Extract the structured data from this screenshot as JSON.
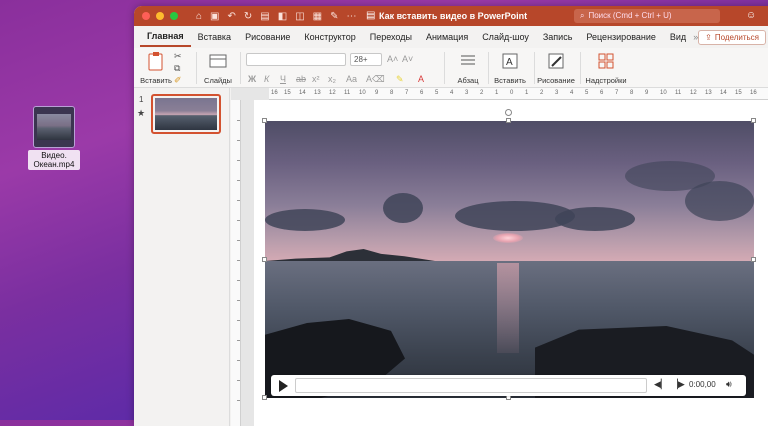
{
  "desktop": {
    "file_label": "Видео. Океан.mp4"
  },
  "titlebar": {
    "title": "Как вставить видео в PowerPoint",
    "search_placeholder": "Поиск (Cmd + Ctrl + U)"
  },
  "tabs": [
    "Главная",
    "Вставка",
    "Рисование",
    "Конструктор",
    "Переходы",
    "Анимация",
    "Слайд-шоу",
    "Запись",
    "Рецензирование",
    "Вид"
  ],
  "share_label": "Поделиться",
  "toolbar": {
    "paste": "Вставить",
    "slides": "Слайды",
    "font_size": "28+",
    "paragraph": "Абзац",
    "insert": "Вставить",
    "drawing": "Рисование",
    "addins": "Надстройки"
  },
  "slide_pane": {
    "number": "1"
  },
  "ruler": {
    "labels": [
      "16",
      "15",
      "14",
      "13",
      "12",
      "11",
      "10",
      "9",
      "8",
      "7",
      "6",
      "5",
      "4",
      "3",
      "2",
      "1",
      "0",
      "1",
      "2",
      "3",
      "4",
      "5",
      "6",
      "7",
      "8",
      "9",
      "10",
      "11",
      "12",
      "13",
      "14",
      "15",
      "16"
    ]
  },
  "player": {
    "time": "0:00,00"
  },
  "colors": {
    "brand": "#b7472a",
    "accent": "#d35230"
  }
}
